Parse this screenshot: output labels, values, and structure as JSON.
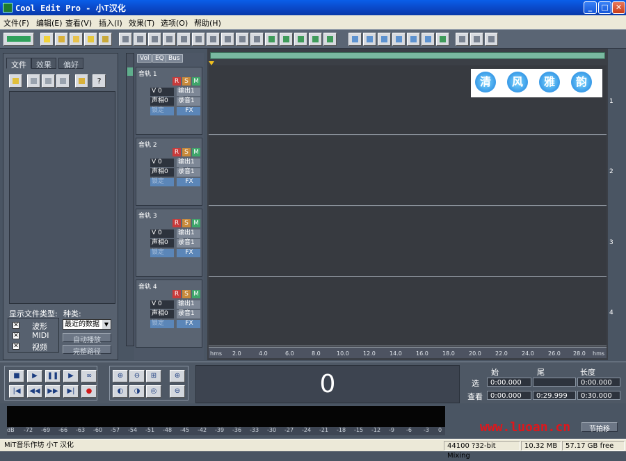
{
  "window": {
    "title": "Cool Edit Pro  - 小T汉化",
    "minimize": "_",
    "maximize": "□",
    "close": "✕"
  },
  "menu": [
    "文件(F)",
    "编辑(E)",
    "查看(V)",
    "插入(I)",
    "效果(T)",
    "选项(O)",
    "帮助(H)"
  ],
  "left_panel": {
    "tabs": [
      "文件",
      "效果",
      "偏好"
    ],
    "help": "?",
    "show_types_label": "显示文件类型:",
    "category_label": "种类:",
    "types": [
      {
        "label": "波形",
        "checked": true
      },
      {
        "label": "MIDI",
        "checked": true
      },
      {
        "label": "视频",
        "checked": true
      }
    ],
    "sort_value": "最近的数据",
    "auto_play": "自动播放",
    "full_path": "完整路径"
  },
  "tracks_tabs": [
    "Vol",
    "EQ",
    "Bus"
  ],
  "tracks": [
    {
      "name": "音轨  1",
      "vol": "V 0",
      "out": "输出1",
      "pan": "声相0",
      "record": "录音1",
      "lock": "锁定",
      "fx": "FX"
    },
    {
      "name": "音轨  2",
      "vol": "V 0",
      "out": "输出1",
      "pan": "声相0",
      "record": "录音1",
      "lock": "锁定",
      "fx": "FX"
    },
    {
      "name": "音轨  3",
      "vol": "V 0",
      "out": "输出1",
      "pan": "声相0",
      "record": "录音1",
      "lock": "锁定",
      "fx": "FX"
    },
    {
      "name": "音轨  4",
      "vol": "V 0",
      "out": "输出1",
      "pan": "声相0",
      "record": "录音1",
      "lock": "锁定",
      "fx": "FX"
    }
  ],
  "track_buttons": {
    "r": "R",
    "s": "S",
    "m": "M"
  },
  "lane_numbers": [
    "1",
    "2",
    "3",
    "4"
  ],
  "ruler": [
    "hms",
    "2.0",
    "4.0",
    "6.0",
    "8.0",
    "10.0",
    "12.0",
    "14.0",
    "16.0",
    "18.0",
    "20.0",
    "22.0",
    "24.0",
    "26.0",
    "28.0",
    "hms"
  ],
  "watermark": [
    "清",
    "风",
    "雅",
    "韵"
  ],
  "time_display": "0",
  "selection": {
    "headers": [
      "始",
      "尾",
      "长度"
    ],
    "row_sel_label": "选",
    "row_view_label": "查看",
    "sel_start": "0:00.000",
    "sel_end": "",
    "sel_length": "0:00.000",
    "view_start": "0:00.000",
    "view_end": "0:29.999",
    "view_length": "0:30.000",
    "offset_label": "节拍移"
  },
  "meter_scale": [
    "dB",
    "-72",
    "-69",
    "-66",
    "-63",
    "-60",
    "-57",
    "-54",
    "-51",
    "-48",
    "-45",
    "-42",
    "-39",
    "-36",
    "-33",
    "-30",
    "-27",
    "-24",
    "-21",
    "-18",
    "-15",
    "-12",
    "-9",
    "-6",
    "-3",
    "0"
  ],
  "status": {
    "left": "MiT音乐作坊 小T 汉化",
    "format": "44100 ?32-bit Mixing",
    "size": "10.32 MB",
    "free": "57.17 GB free"
  },
  "site_watermark": "www.luoan.cn"
}
